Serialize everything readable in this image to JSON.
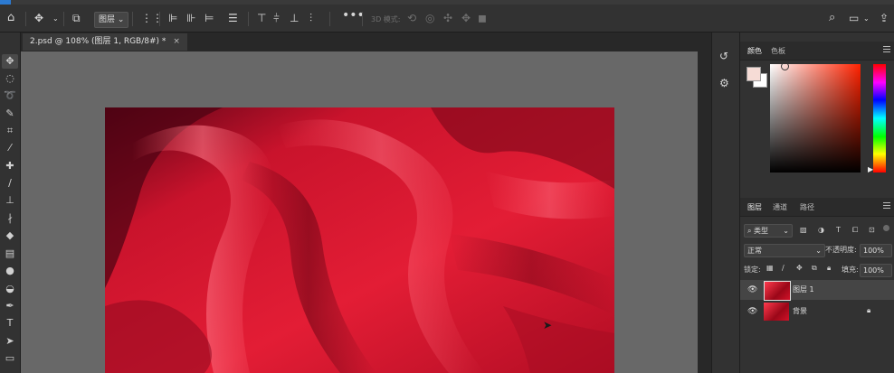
{
  "options_bar": {
    "layer_select_label": "图层",
    "mode_3d_label": "3D 模式:"
  },
  "document": {
    "tab_title": "2.psd @ 108% (图层 1, RGB/8#) *",
    "close_glyph": "×"
  },
  "color_panel": {
    "tabs": [
      "颜色",
      "色板"
    ],
    "foreground": "#f6dcd6",
    "background": "#ffffff",
    "hue_color": "#ff2200"
  },
  "layers_panel": {
    "tabs": [
      "图层",
      "通道",
      "路径"
    ],
    "filter_label": "类型",
    "blend_mode": "正常",
    "opacity_label": "不透明度:",
    "opacity_value": "100%",
    "lock_label": "锁定:",
    "fill_label": "填充:",
    "fill_value": "100%",
    "layers": [
      {
        "name": "图层 1",
        "selected": true,
        "locked": false
      },
      {
        "name": "背景",
        "selected": false,
        "locked": true
      }
    ]
  },
  "colors": {
    "accent": "#2c7ad1",
    "canvas_bg": "#686868",
    "panel_bg": "#323232"
  }
}
